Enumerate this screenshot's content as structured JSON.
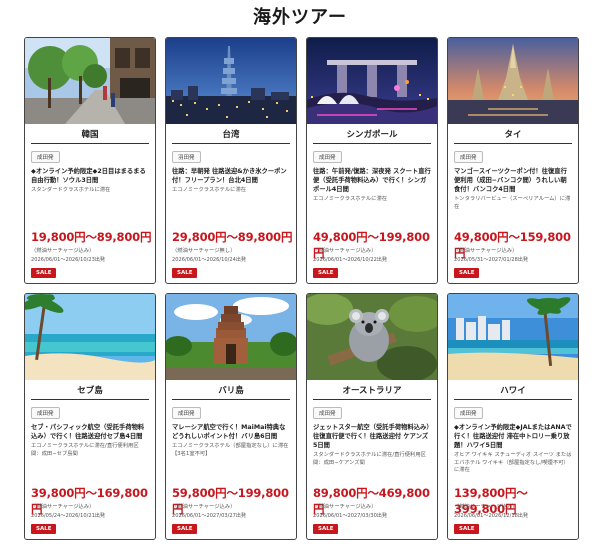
{
  "page_title": "海外ツアー",
  "colors": {
    "accent_red": "#c8161d",
    "border": "#444444"
  },
  "tours": [
    {
      "destination": "韓国",
      "image": "seoul-street-photo",
      "origin": "成田発",
      "title": "◆オンライン予約限定◆2日目はまるまる自由行動！ソウル3日間",
      "hotel": "スタンダードクラスホテルに滞在",
      "price": "19,800円〜89,800円",
      "surcharge": "（燃油サーチャージ込み）",
      "period": "2026/06/01〜2026/10/23出発",
      "badge": "SALE"
    },
    {
      "destination": "台湾",
      "image": "taipei-skyline-photo",
      "origin": "羽田発",
      "title": "往路：早朝発 往路送迎&かき氷クーポン付！フリープラン！台北4日間",
      "hotel": "エコノミークラスホテルに滞在",
      "price": "29,800円〜89,800円",
      "surcharge": "（燃油サーチャージ無し）",
      "period": "2026/06/01〜2026/10/24出発",
      "badge": "SALE"
    },
    {
      "destination": "シンガポール",
      "image": "singapore-night-photo",
      "origin": "成田発",
      "title": "往路：午前発/復路：深夜発 スクート直行便（受託手荷物料込み）で行く！シンガポール4日間",
      "hotel": "エコノミークラスホテルに滞在",
      "price": "49,800円〜199,800円",
      "surcharge": "（燃油サーチャージ込み）",
      "period": "2026/06/01〜2026/10/22出発",
      "badge": "SALE"
    },
    {
      "destination": "タイ",
      "image": "bangkok-temple-photo",
      "origin": "成田発",
      "title": "マンゴースイーツクーポン付！往復直行便利用（成田−バンコク間）うれしい朝食付！バンコク4日間",
      "hotel": "トンタラリバービュー（スーペリアルーム）に滞在",
      "price": "49,800円〜159,800円",
      "surcharge": "（燃油サーチャージ込み）",
      "period": "2026/05/31〜2027/01/28出発",
      "badge": "SALE"
    },
    {
      "destination": "セブ島",
      "image": "cebu-beach-photo",
      "origin": "成田発",
      "title": "セブ・パシフィック航空（受託手荷物料込み）で行く！往路送迎付セブ島4日間",
      "hotel": "エコノミークラスホテルに滞在/直行便利用区間：成田−セブ島間",
      "price": "39,800円〜169,800円",
      "surcharge": "（燃油サーチャージ込み）",
      "period": "2026/05/24〜2026/10/21出発",
      "badge": "SALE"
    },
    {
      "destination": "バリ島",
      "image": "bali-temple-photo",
      "origin": "成田発",
      "title": "マレーシア航空で行く！MaiMai特典などうれしいポイント付！バリ島6日間",
      "hotel": "エコノミークラスホテル（部屋指定なし）に滞在【3名1室不可】",
      "price": "59,800円〜199,800円",
      "surcharge": "（燃油サーチャージ込み）",
      "period": "2026/06/01〜2027/03/27出発",
      "badge": "SALE"
    },
    {
      "destination": "オーストラリア",
      "image": "koala-photo",
      "origin": "成田発",
      "title": "ジェットスター航空（受託手荷物料込み）往復直行便で行く！往路送迎付 ケアンズ5日間",
      "hotel": "スタンダードクラスホテルに滞在/直行便利用区間：成田−ケアンズ間",
      "price": "89,800円〜469,800円",
      "surcharge": "（燃油サーチャージ込み）",
      "period": "2026/06/01〜2027/03/30出発",
      "badge": "SALE"
    },
    {
      "destination": "ハワイ",
      "image": "waikiki-beach-photo",
      "origin": "成田発",
      "title": "◆オンライン予約限定◆JALまたはANAで行く！往路送迎付 滞在中トロリー乗り放題！ハワイ5日間",
      "hotel": "オヒア ワイキキ スチューディオ スイーツ または エバホテル ワイキキ（部屋指定なし/喫煙不可）に滞在",
      "price": "139,800円〜399,800円",
      "surcharge": "（燃油サーチャージ込み）",
      "period": "2026/06/01〜2026/12/18出発",
      "badge": "SALE"
    }
  ]
}
